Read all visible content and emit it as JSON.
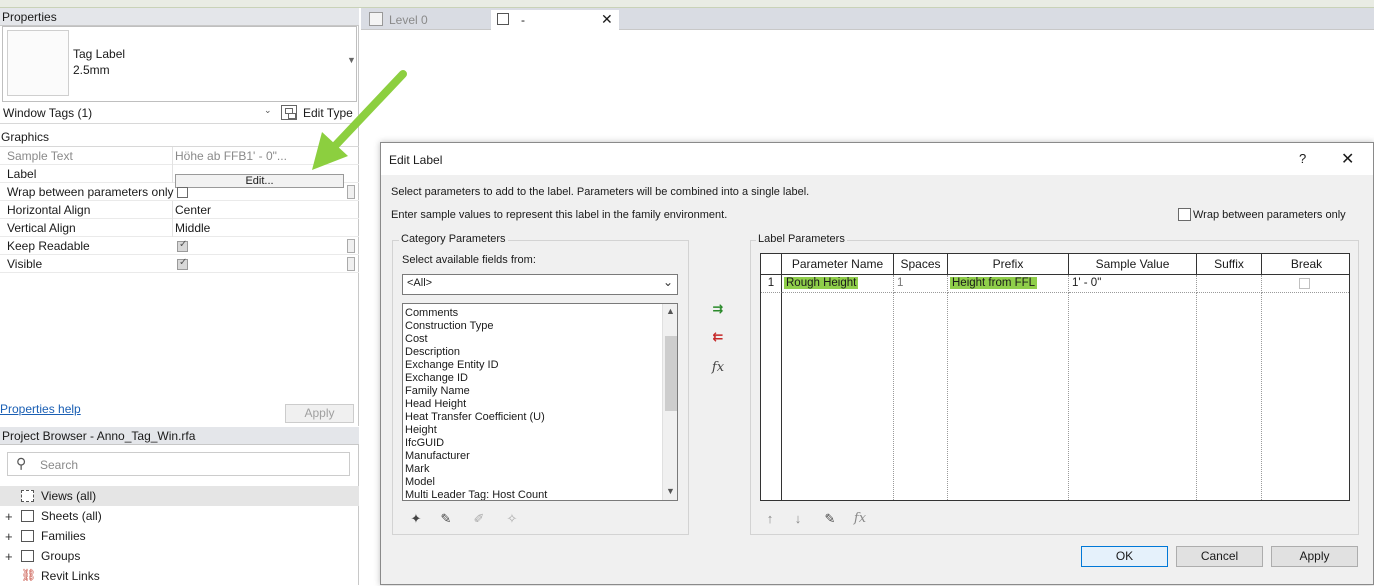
{
  "properties": {
    "header": "Properties",
    "type_name": "Tag Label",
    "type_size": "2.5mm",
    "selector": "Window Tags (1)",
    "edit_type": "Edit Type",
    "section": "Graphics",
    "rows": {
      "sample_text": {
        "label": "Sample Text",
        "value": "Höhe ab FFB1' - 0\"..."
      },
      "label": {
        "label": "Label",
        "button": "Edit..."
      },
      "wrap": {
        "label": "Wrap between parameters only"
      },
      "halign": {
        "label": "Horizontal Align",
        "value": "Center"
      },
      "valign": {
        "label": "Vertical Align",
        "value": "Middle"
      },
      "keep_readable": {
        "label": "Keep Readable"
      },
      "visible": {
        "label": "Visible"
      }
    },
    "help_link": "Properties help",
    "apply": "Apply"
  },
  "browser": {
    "header": "Project Browser - Anno_Tag_Win.rfa",
    "search_placeholder": "Search",
    "items": [
      "Views (all)",
      "Sheets (all)",
      "Families",
      "Groups",
      "Revit Links"
    ]
  },
  "tabs": [
    {
      "label": "Level 0"
    },
    {
      "label": "-"
    }
  ],
  "dialog": {
    "title": "Edit Label",
    "help": "?",
    "intro1": "Select parameters to add to the label.  Parameters will be combined into a single label.",
    "intro2": "Enter sample values to represent this label in the family environment.",
    "wrap_label": "Wrap between parameters only",
    "category": {
      "title": "Category Parameters",
      "select_label": "Select available fields from:",
      "combo_value": "<All>",
      "fields": [
        "Comments",
        "Construction Type",
        "Cost",
        "Description",
        "Exchange Entity ID",
        "Exchange ID",
        "Family Name",
        "Head Height",
        "Heat Transfer Coefficient (U)",
        "Height",
        "IfcGUID",
        "Manufacturer",
        "Mark",
        "Model",
        "Multi Leader Tag: Host Count"
      ]
    },
    "label_params": {
      "title": "Label Parameters",
      "columns": [
        "Parameter Name",
        "Spaces",
        "Prefix",
        "Sample Value",
        "Suffix",
        "Break"
      ],
      "rows": [
        {
          "num": "1",
          "name": "Rough Height",
          "spaces": "1",
          "prefix": "Height from FFL",
          "sample": "1' - 0\"",
          "suffix": ""
        }
      ]
    },
    "buttons": {
      "ok": "OK",
      "cancel": "Cancel",
      "apply": "Apply"
    },
    "colors": {
      "highlight": "#8fce4a",
      "arrow": "#8ccf3f"
    }
  }
}
